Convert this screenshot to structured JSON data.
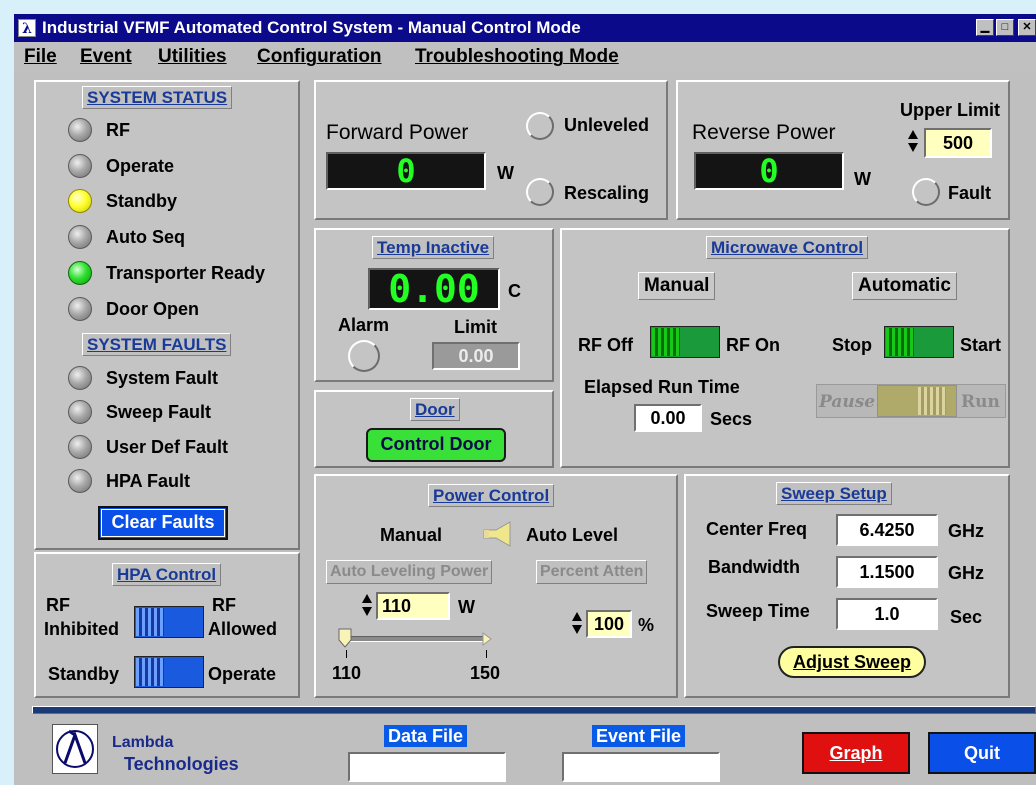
{
  "window": {
    "title": "Industrial VFMF Automated Control System - Manual Control Mode",
    "logo_glyph": "λ",
    "minimize": "▁",
    "maximize": "□",
    "close": "✕"
  },
  "menu": [
    "File",
    "Event",
    "Utilities",
    "Configuration",
    "Troubleshooting Mode"
  ],
  "status": {
    "title": "SYSTEM STATUS",
    "items": [
      {
        "label": "RF",
        "state": "off"
      },
      {
        "label": "Operate",
        "state": "off"
      },
      {
        "label": "Standby",
        "state": "yellow"
      },
      {
        "label": "Auto Seq",
        "state": "off"
      },
      {
        "label": "Transporter Ready",
        "state": "green"
      },
      {
        "label": "Door Open",
        "state": "off"
      }
    ],
    "faults_title": "SYSTEM FAULTS",
    "faults": [
      {
        "label": "System Fault"
      },
      {
        "label": "Sweep Fault"
      },
      {
        "label": "User Def Fault"
      },
      {
        "label": "HPA Fault"
      }
    ],
    "clear_label": "Clear Faults"
  },
  "hpa": {
    "title": "HPA Control",
    "rf_inhibited_1": "RF",
    "rf_inhibited_2": "Inhibited",
    "rf_allowed_1": "RF",
    "rf_allowed_2": "Allowed",
    "standby": "Standby",
    "operate": "Operate"
  },
  "forward": {
    "label": "Forward Power",
    "value": "0",
    "unit": "W",
    "unleveled": "Unleveled",
    "rescaling": "Rescaling"
  },
  "reverse": {
    "label": "Reverse Power",
    "value": "0",
    "unit": "W",
    "upper_limit_label": "Upper Limit",
    "upper_limit": "500",
    "fault": "Fault"
  },
  "temp": {
    "title": "Temp Inactive",
    "value": "0.00",
    "unit": "C",
    "alarm": "Alarm",
    "limit_label": "Limit",
    "limit": "0.00"
  },
  "door": {
    "title": "Door",
    "button": "Control Door"
  },
  "microwave": {
    "title": "Microwave Control",
    "manual": "Manual",
    "automatic": "Automatic",
    "rf_off": "RF Off",
    "rf_on": "RF On",
    "stop": "Stop",
    "start": "Start",
    "elapsed_label": "Elapsed Run Time",
    "elapsed_value": "0.00",
    "elapsed_unit": "Secs",
    "pause": "Pause",
    "run": "Run"
  },
  "power": {
    "title": "Power Control",
    "manual": "Manual",
    "auto_level": "Auto Level",
    "auto_leveling_label": "Auto Leveling Power",
    "percent_atten_label": "Percent Atten",
    "auto_leveling_value": "110",
    "auto_leveling_unit": "W",
    "percent_value": "100",
    "percent_unit": "%",
    "slider_min": "110",
    "slider_max": "150",
    "slider_level": 0.0
  },
  "sweep": {
    "title": "Sweep Setup",
    "center_label": "Center Freq",
    "center_value": "6.4250",
    "center_unit": "GHz",
    "bandwidth_label": "Bandwidth",
    "bandwidth_value": "1.1500",
    "bandwidth_unit": "GHz",
    "time_label": "Sweep Time",
    "time_value": "1.0",
    "time_unit": "Sec",
    "adjust_button": "Adjust Sweep"
  },
  "footer": {
    "company_line1": "Lambda",
    "company_line2": "Technologies",
    "data_file_label": "Data File",
    "data_file_value": "",
    "event_file_label": "Event File",
    "event_file_value": "",
    "graph": "Graph",
    "quit": "Quit"
  },
  "colors": {
    "title_bar": "#0a0a8a",
    "caption_text": "#1a3a98",
    "led_green": "#30e030",
    "led_yellow": "#ffff30",
    "graph_button": "#e01010",
    "quit_button": "#0a50e8",
    "clear_button": "#0a50e8"
  }
}
